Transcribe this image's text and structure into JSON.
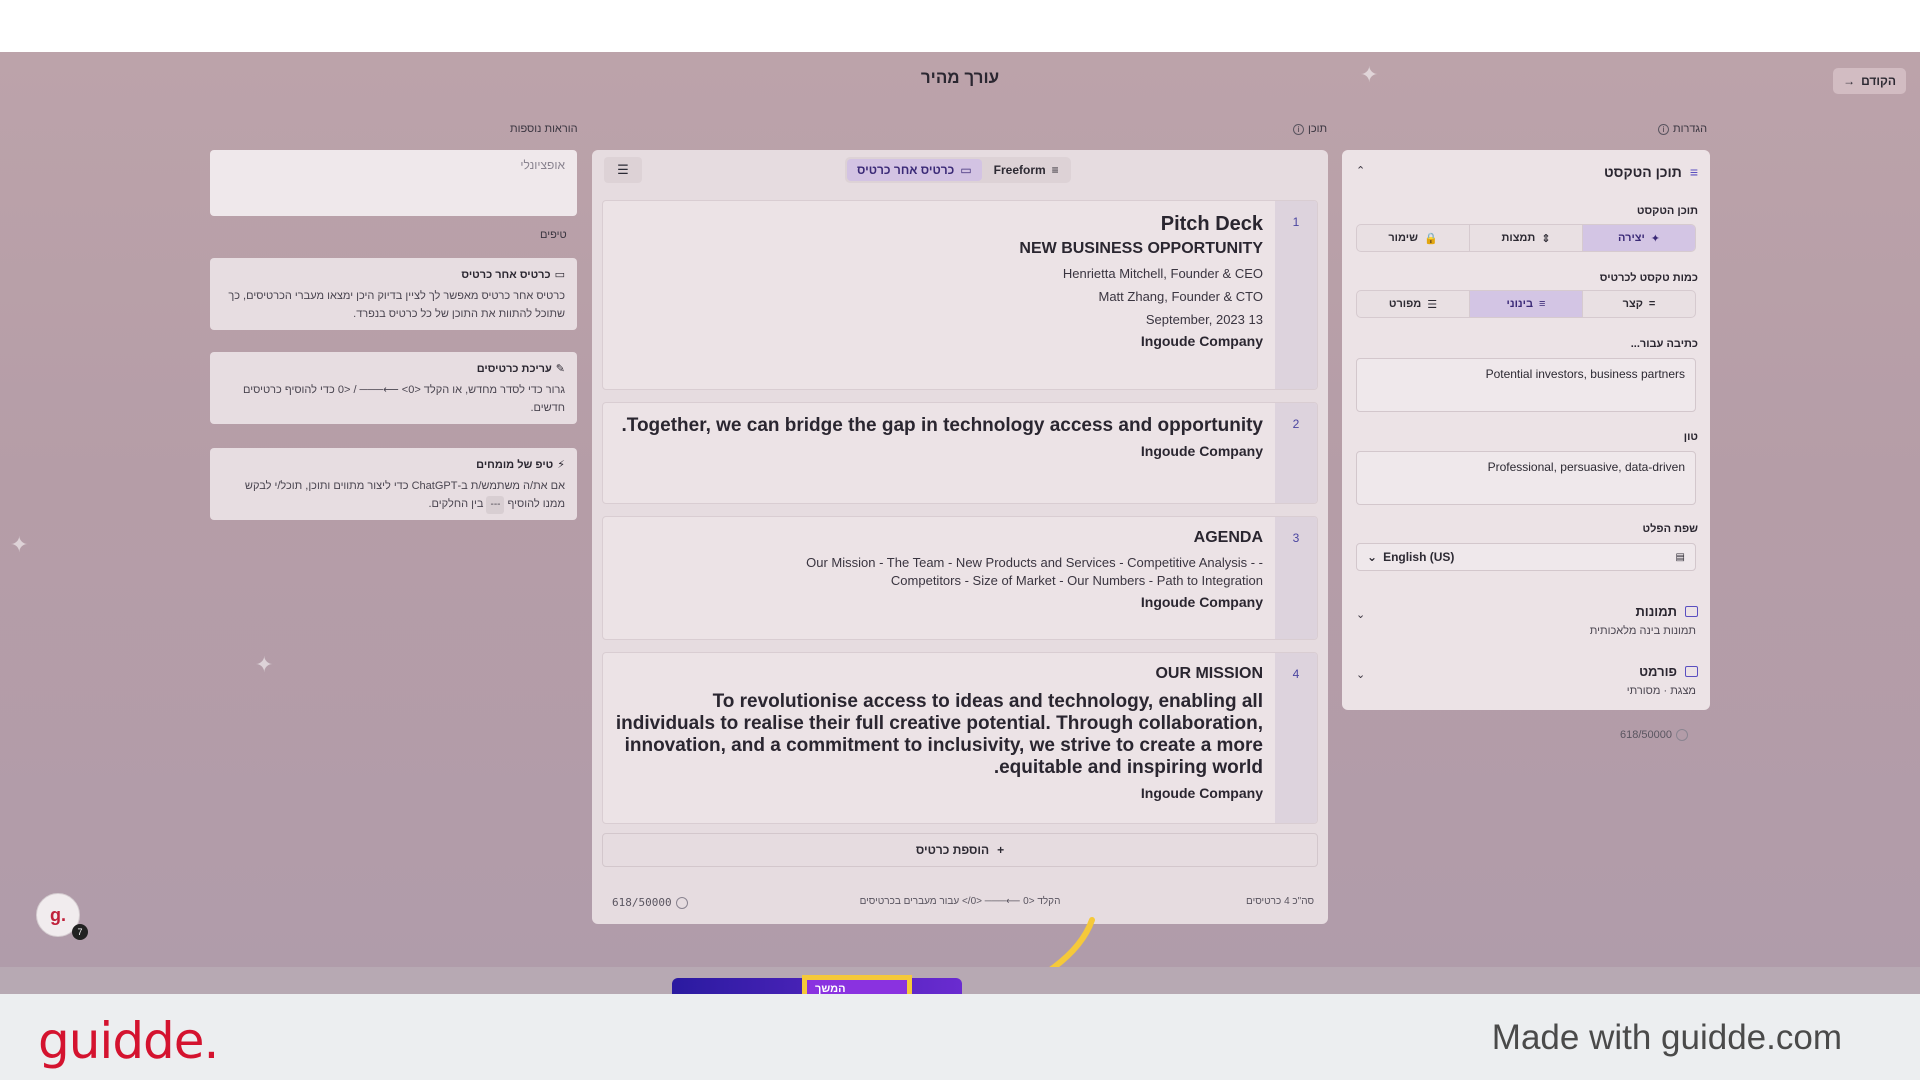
{
  "header": {
    "title": "עורך מהיר",
    "back_label": "הקודם"
  },
  "labels": {
    "settings": "הגדרות",
    "content": "תוכן",
    "extra_instructions": "הוראות נוספות",
    "tips": "טיפים"
  },
  "left": {
    "optional_placeholder": "אופציונלי",
    "tips": [
      {
        "title": "כרטיס אחר כרטיס",
        "body": "כרטיס אחר כרטיס מאפשר לך לציין בדיוק היכן ימצאו מעברי הכרטיסים, כך שתוכל להתוות את התוכן של כל כרטיס בנפרד."
      },
      {
        "title": "עריכת כרטיסים",
        "body": "גרור כדי לסדר מחדש, או הקלד <0> ⟵─── / <0 כדי להוסיף כרטיסים חדשים."
      },
      {
        "title": "טיפ של מומחים",
        "body_1": "אם את/ה משתמש/ת ב-ChatGPT כדי ליצור מתווים ותוכן, תוכל/י לבקש ממנו להוסיף",
        "kbd": "---",
        "body_2": "בין החלקים."
      }
    ]
  },
  "center": {
    "toggles": {
      "freeform": "Freeform",
      "card_by_card": "כרטיס אחר כרטיס"
    },
    "slides": [
      {
        "num": "1",
        "title": "Pitch Deck",
        "subtitle": "NEW BUSINESS OPPORTUNITY",
        "lines": [
          "Henrietta Mitchell, Founder & CEO",
          "Matt Zhang, Founder & CTO",
          "13 September, 2023"
        ],
        "company": "Ingoude Company"
      },
      {
        "num": "2",
        "title": "Together, we can bridge the gap in technology access and opportunity.",
        "company": "Ingoude Company"
      },
      {
        "num": "3",
        "title": "AGENDA",
        "line1": "- - Our Mission - The Team - New Products and Services - Competitive Analysis",
        "line2": "Competitors - Size of Market - Our Numbers - Path to Integration",
        "company": "Ingoude Company"
      },
      {
        "num": "4",
        "title": "OUR MISSION",
        "body": "To revolutionise access to ideas and technology, enabling all individuals to realise their full creative potential. Through collaboration, innovation, and a commitment to inclusivity, we strive to create a more equitable and inspiring world.",
        "company": "Ingoude Company"
      }
    ],
    "add_card": "הוספת כרטיס",
    "footer": {
      "counter": "618/50000",
      "hint": "הקלד <0 ⟵─── <0/> עבור מעברים בכרטיסים",
      "total": "סה\"כ 4 כרטיסים"
    }
  },
  "right": {
    "section_title": "תוכן הטקסט",
    "text_content_label": "תוכן הטקסט",
    "text_modes": [
      "יצירה",
      "תמצות",
      "שימור"
    ],
    "amount_label": "כמות טקסט לכרטיס",
    "amounts": [
      "קצר",
      "בינוני",
      "מפורט"
    ],
    "audience_label": "כתיבה עבור...",
    "audience_value": "Potential investors, business partners",
    "tone_label": "טון",
    "tone_value": "Professional, persuasive, data-driven",
    "lang_label": "שפת הפלט",
    "lang_value": "English (US)",
    "images_title": "תמונות",
    "images_sub": "תמונות בינה מלאכותית",
    "format_title": "פורמט",
    "format_sub": "מצגת · מסורתי",
    "counter": "618/50000"
  },
  "bottom": {
    "action_label": "המשך",
    "avatar_letter": "g.",
    "avatar_badge": "7"
  },
  "footer": {
    "brand": "guidde.",
    "made_with": "Made with guidde.com"
  },
  "colors": {
    "accent": "#5a4fc0",
    "brand_red": "#d4132f",
    "highlight": "#f5c93a"
  }
}
